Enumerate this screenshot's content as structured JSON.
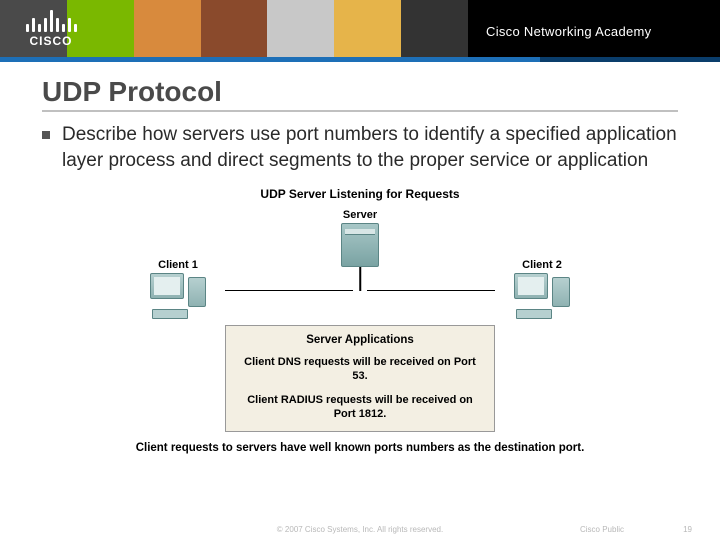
{
  "header": {
    "logo_word": "CISCO",
    "academy_label": "Cisco Networking Academy"
  },
  "slide": {
    "title": "UDP Protocol",
    "bullet": "Describe how servers use port numbers to identify a specified application layer process and direct segments to the proper service or application"
  },
  "diagram": {
    "title": "UDP Server Listening for Requests",
    "server_label": "Server",
    "client1_label": "Client 1",
    "client2_label": "Client 2",
    "panel_title": "Server Applications",
    "panel_line1": "Client DNS requests will be received on Port 53.",
    "panel_line2": "Client RADIUS requests will be received on Port 1812.",
    "caption": "Client requests to servers have well known ports numbers as the destination port."
  },
  "footer": {
    "copyright": "© 2007 Cisco Systems, Inc. All rights reserved.",
    "public": "Cisco Public",
    "page_number": "19"
  }
}
